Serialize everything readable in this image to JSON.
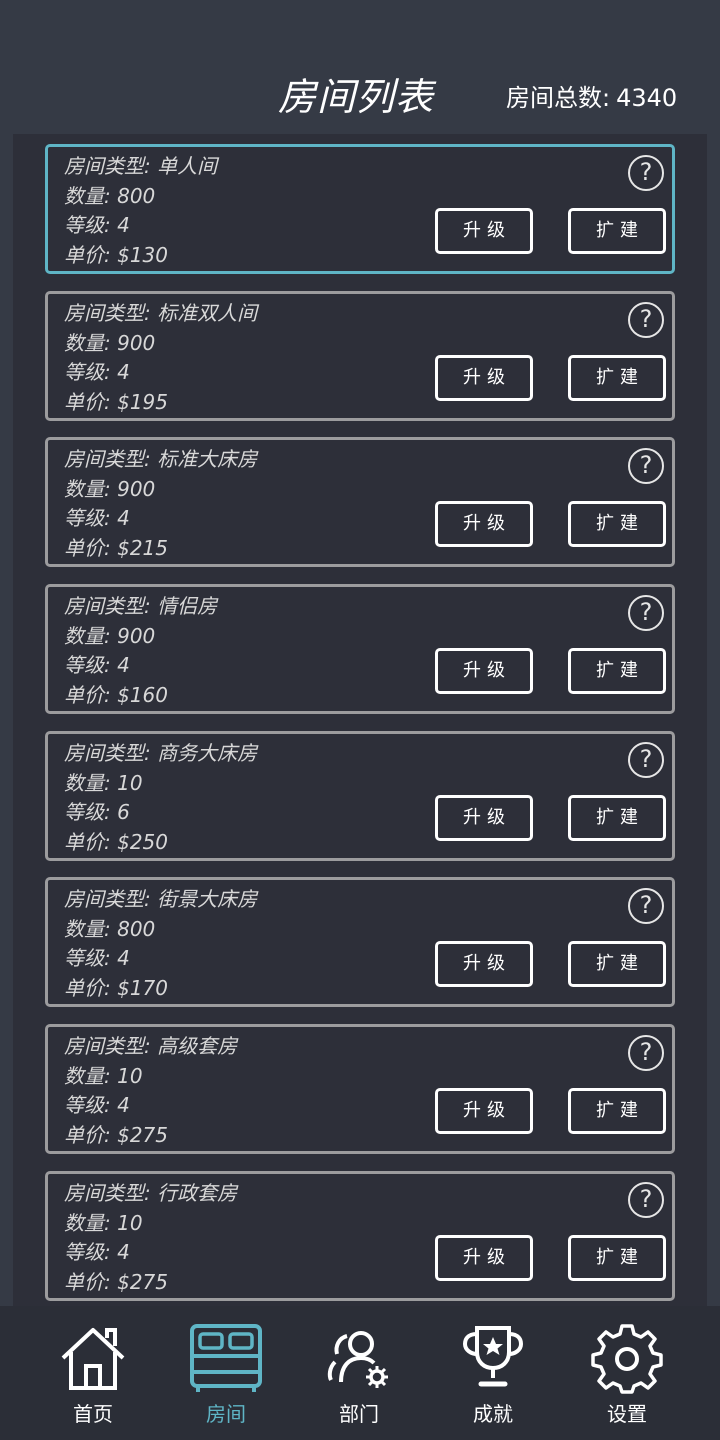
{
  "header": {
    "title": "房间列表",
    "total_label": "房间总数:",
    "total_value": "4340"
  },
  "rooms": [
    {
      "type_label": "房间类型: 单人间",
      "count_label": "数量: 800",
      "level_label": "等级: 4",
      "price_label": "单价: $130",
      "selected": true
    },
    {
      "type_label": "房间类型: 标准双人间",
      "count_label": "数量: 900",
      "level_label": "等级: 4",
      "price_label": "单价: $195",
      "selected": false
    },
    {
      "type_label": "房间类型: 标准大床房",
      "count_label": "数量: 900",
      "level_label": "等级: 4",
      "price_label": "单价: $215",
      "selected": false
    },
    {
      "type_label": "房间类型: 情侣房",
      "count_label": "数量: 900",
      "level_label": "等级: 4",
      "price_label": "单价: $160",
      "selected": false
    },
    {
      "type_label": "房间类型: 商务大床房",
      "count_label": "数量: 10",
      "level_label": "等级: 6",
      "price_label": "单价: $250",
      "selected": false
    },
    {
      "type_label": "房间类型: 街景大床房",
      "count_label": "数量: 800",
      "level_label": "等级: 4",
      "price_label": "单价: $170",
      "selected": false
    },
    {
      "type_label": "房间类型: 高级套房",
      "count_label": "数量: 10",
      "level_label": "等级: 4",
      "price_label": "单价: $275",
      "selected": false
    },
    {
      "type_label": "房间类型: 行政套房",
      "count_label": "数量: 10",
      "level_label": "等级: 4",
      "price_label": "单价: $275",
      "selected": false
    }
  ],
  "buttons": {
    "upgrade": "升级",
    "expand": "扩建",
    "help": "?"
  },
  "nav": {
    "items": [
      {
        "label": "首页",
        "icon": "home-icon",
        "active": false
      },
      {
        "label": "房间",
        "icon": "bed-icon",
        "active": true
      },
      {
        "label": "部门",
        "icon": "team-settings-icon",
        "active": false
      },
      {
        "label": "成就",
        "icon": "trophy-icon",
        "active": false
      },
      {
        "label": "设置",
        "icon": "gear-icon",
        "active": false
      }
    ]
  },
  "colors": {
    "background": "#353a45",
    "panel": "#2d2f39",
    "accent": "#5fb5c6",
    "card_border": "#9c9c9e"
  }
}
